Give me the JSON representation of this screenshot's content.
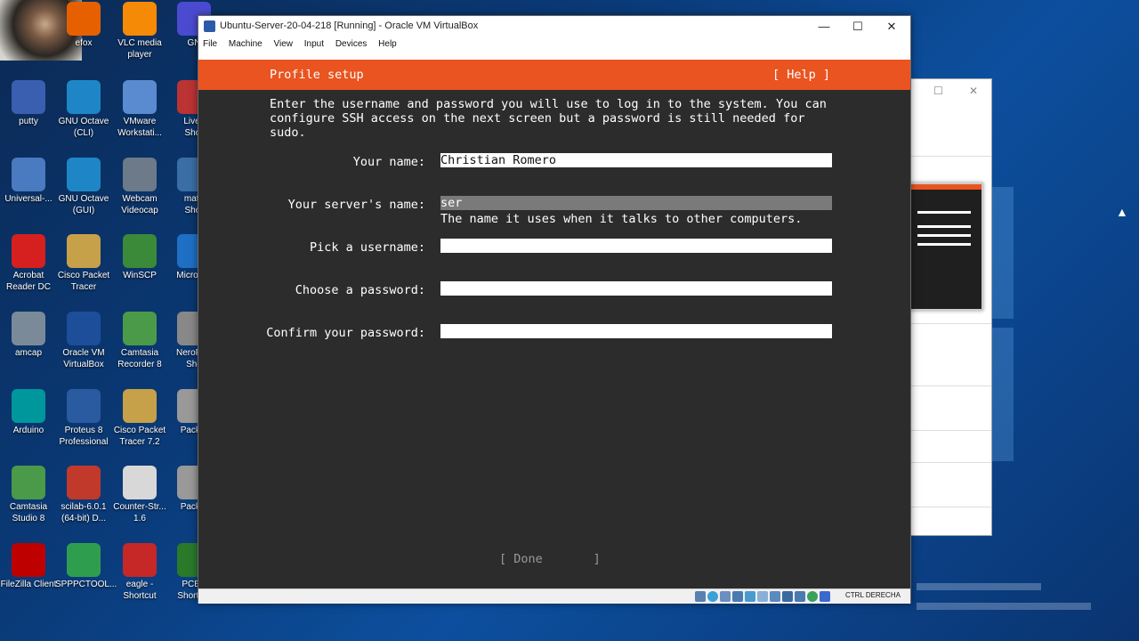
{
  "desktop": {
    "icons": [
      {
        "label": "efox",
        "color": "#e66000"
      },
      {
        "label": "VLC media player",
        "color": "#f58a07"
      },
      {
        "label": "GN",
        "color": "#4b4bd1"
      },
      {
        "label": "putty",
        "color": "#3a5fb0"
      },
      {
        "label": "GNU Octave (CLI)",
        "color": "#1e86c6"
      },
      {
        "label": "VMware Workstati...",
        "color": "#5a8bd0"
      },
      {
        "label": "Livev Shor",
        "color": "#b33"
      },
      {
        "label": "Universal-...",
        "color": "#4a7ac0"
      },
      {
        "label": "GNU Octave (GUI)",
        "color": "#1e86c6"
      },
      {
        "label": "Webcam Videocap",
        "color": "#6c7a89"
      },
      {
        "label": "math Shor",
        "color": "#3a6ea5"
      },
      {
        "label": "Acrobat Reader DC",
        "color": "#d61f1f"
      },
      {
        "label": "Cisco Packet Tracer",
        "color": "#c7a04a"
      },
      {
        "label": "WinSCP",
        "color": "#3a8a3a"
      },
      {
        "label": "Micro Ed",
        "color": "#1f6fc4"
      },
      {
        "label": "amcap",
        "color": "#7a8a99"
      },
      {
        "label": "Oracle VM VirtualBox",
        "color": "#1d4e9a"
      },
      {
        "label": "Camtasia Recorder 8",
        "color": "#4a9a4a"
      },
      {
        "label": "NeroPo - Sho",
        "color": "#888"
      },
      {
        "label": "Arduino",
        "color": "#00979c"
      },
      {
        "label": "Proteus 8 Professional",
        "color": "#2a5aa0"
      },
      {
        "label": "Cisco Packet Tracer 7.2",
        "color": "#c7a04a"
      },
      {
        "label": "Packet",
        "color": "#999"
      },
      {
        "label": "Camtasia Studio 8",
        "color": "#4a9a4a"
      },
      {
        "label": "scilab-6.0.1 (64-bit) D...",
        "color": "#c0392b"
      },
      {
        "label": "Counter-Str... 1.6",
        "color": "#d8d8d8"
      },
      {
        "label": "Packet",
        "color": "#999"
      },
      {
        "label": "FileZilla Client",
        "color": "#bf0000"
      },
      {
        "label": "SPPPCTOOL...",
        "color": "#2e9e4e"
      },
      {
        "label": "eagle - Shortcut",
        "color": "#c62828"
      },
      {
        "label": "PCBV Shortcut",
        "color": "#2a7a2a"
      }
    ]
  },
  "vbox": {
    "title": "Ubuntu-Server-20-04-218 [Running] - Oracle VM VirtualBox",
    "controls": {
      "minimize": "—",
      "maximize": "☐",
      "close": "✕"
    },
    "menu": [
      "File",
      "Machine",
      "View",
      "Input",
      "Devices",
      "Help"
    ],
    "host_key": "CTRL DERECHA"
  },
  "installer": {
    "title": "Profile setup",
    "help": "[ Help ]",
    "intro": "Enter the username and password you will use to log in to the system. You can\nconfigure SSH access on the next screen but a password is still needed for\nsudo.",
    "fields": {
      "name": {
        "label": "Your name:",
        "value": "Christian Romero"
      },
      "server": {
        "label": "Your server's name:",
        "value": "ser",
        "hint": "The name it uses when it talks to other computers."
      },
      "username": {
        "label": "Pick a username:",
        "value": ""
      },
      "password": {
        "label": "Choose a password:",
        "value": ""
      },
      "confirm": {
        "label": "Confirm your password:",
        "value": ""
      }
    },
    "done": "[ Done       ]"
  },
  "bgwin": {
    "controls": {
      "maximize": "☐",
      "close": "✕"
    }
  },
  "colors": {
    "accent": "#e95420",
    "terminal_bg": "#2c2c2c"
  }
}
